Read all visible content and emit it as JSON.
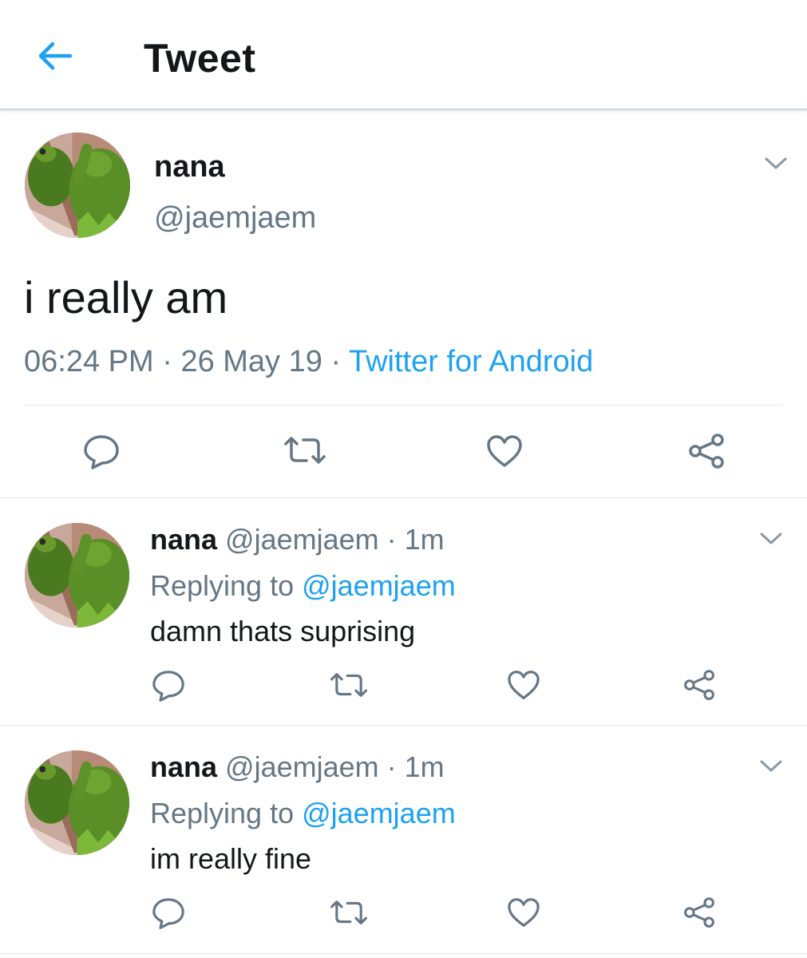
{
  "header": {
    "title": "Tweet",
    "back_icon": "arrow-left-icon",
    "accent_color": "#1da1f2"
  },
  "main_tweet": {
    "name": "nana",
    "handle": "@jaemjaem",
    "text": "i really am",
    "time": "06:24 PM",
    "separator": " · ",
    "date": "26 May 19",
    "source": "Twitter for Android"
  },
  "replies": [
    {
      "name": "nana",
      "handle": "@jaemjaem",
      "time_sep": " · ",
      "time": "1m",
      "replying_prefix": "Replying to ",
      "replying_to": "@jaemjaem",
      "text": "damn thats suprising"
    },
    {
      "name": "nana",
      "handle": "@jaemjaem",
      "time_sep": " · ",
      "time": "1m",
      "replying_prefix": "Replying to ",
      "replying_to": "@jaemjaem",
      "text": "im really fine"
    }
  ],
  "actions": [
    "reply-icon",
    "retweet-icon",
    "like-icon",
    "share-icon"
  ],
  "colors": {
    "text_primary": "#14171a",
    "text_secondary": "#657786",
    "link": "#1da1f2",
    "icon": "#657786"
  }
}
